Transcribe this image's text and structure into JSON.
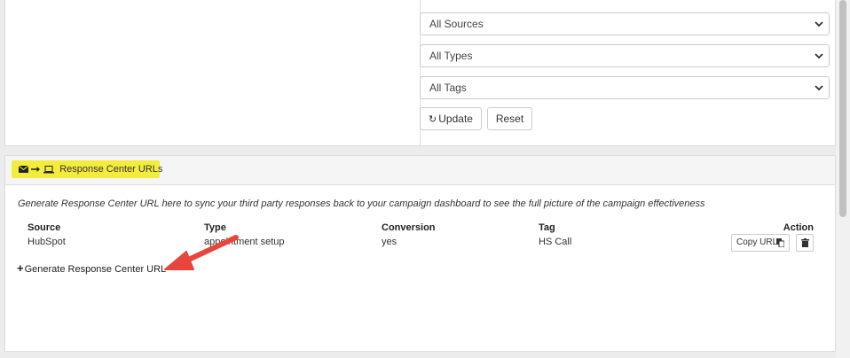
{
  "filters": {
    "sources_value": "All Sources",
    "types_value": "All Types",
    "tags_value": "All Tags",
    "update_label": "Update",
    "reset_label": "Reset"
  },
  "response_center": {
    "title": "Response Center URLs",
    "description": "Generate Response Center URL here to sync your third party responses back to your campaign dashboard to see the full picture of the campaign effectiveness",
    "columns": {
      "source": "Source",
      "type": "Type",
      "conversion": "Conversion",
      "tag": "Tag",
      "action": "Action"
    },
    "rows": [
      {
        "source": "HubSpot",
        "type": "appointment setup",
        "conversion": "yes",
        "tag": "HS Call",
        "copy_label": "Copy URL"
      }
    ],
    "generate_label": "Generate Response Center URL"
  },
  "colors": {
    "highlight": "#f4ec3c",
    "arrow": "#e8453c"
  }
}
